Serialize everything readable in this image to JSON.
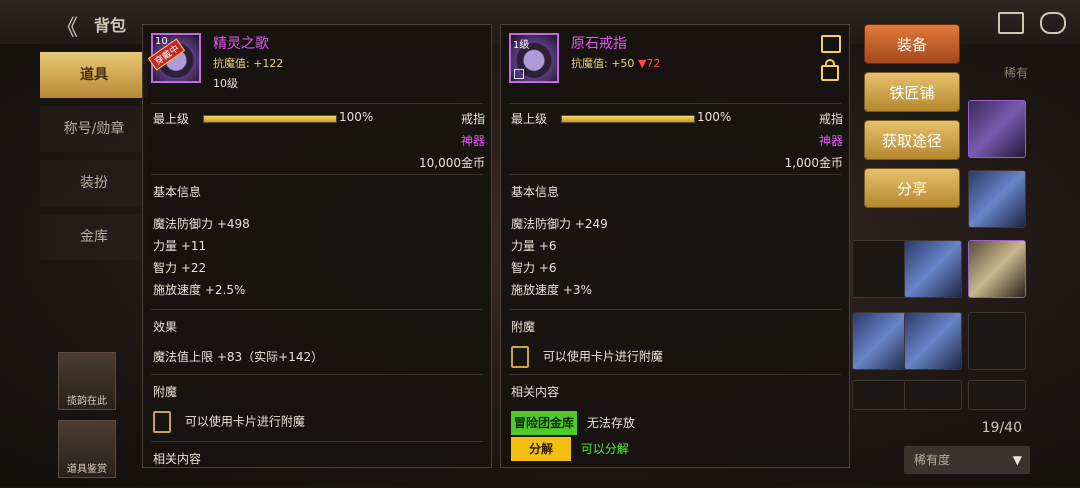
{
  "top": {
    "title": "背包",
    "back": "back"
  },
  "left_nav": {
    "items": [
      "道具",
      "称号/勋章",
      "装扮",
      "金库"
    ],
    "active_index": 0
  },
  "left_shortcuts": [
    {
      "label": "揽韵在此"
    },
    {
      "label": "道具鉴赏"
    }
  ],
  "actions": {
    "equip": "装备",
    "smith": "铁匠铺",
    "source": "获取途径",
    "share": "分享"
  },
  "inventory": {
    "tab": "稀有",
    "count": "19/40",
    "rarity_filter": "稀有度"
  },
  "tooltip_left": {
    "level_tag": "10",
    "badge": "穿戴中",
    "name": "精灵之歌",
    "stat_label": "抗魔值:",
    "stat_value": "+122",
    "level_text": "10级",
    "grade_label": "最上级",
    "grade_pct": 100,
    "grade_pct_text": "100%",
    "type": "戒指",
    "rarity": "神器",
    "price": "10,000金币",
    "basic_title": "基本信息",
    "attrs": [
      "魔法防御力 +498",
      "力量 +11",
      "智力 +22",
      "施放速度 +2.5%"
    ],
    "effect_title": "效果",
    "effect_text": "魔法值上限 +83（实际+142）",
    "enchant_title": "附魔",
    "enchant_text": "可以使用卡片进行附魔",
    "related_title": "相关内容"
  },
  "tooltip_right": {
    "level_tag": "1级",
    "name": "原石戒指",
    "stat_label": "抗魔值:",
    "stat_value": "+50",
    "stat_diff": "▼72",
    "grade_label": "最上级",
    "grade_pct": 100,
    "grade_pct_text": "100%",
    "type": "戒指",
    "rarity": "神器",
    "price": "1,000金币",
    "basic_title": "基本信息",
    "attrs": [
      "魔法防御力 +249",
      "力量 +6",
      "智力 +6",
      "施放速度 +3%"
    ],
    "enchant_title": "附魔",
    "enchant_text": "可以使用卡片进行附魔",
    "related_title": "相关内容",
    "related": [
      {
        "badge": "冒险团金库",
        "text": "无法存放"
      },
      {
        "badge": "分解",
        "text": "可以分解"
      }
    ]
  },
  "colors": {
    "epic": "#e058f0",
    "gold": "#e8d080",
    "down": "#ff4a4a",
    "green": "#4ef02a"
  }
}
